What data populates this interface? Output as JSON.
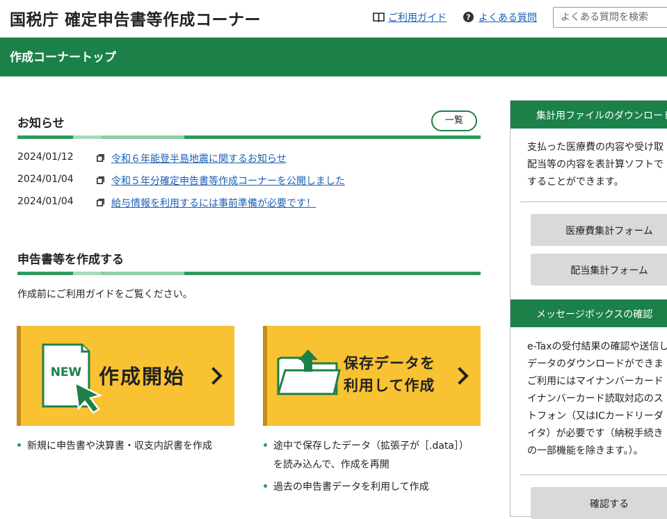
{
  "header": {
    "title": "国税庁 確定申告書等作成コーナー",
    "guide_link": "ご利用ガイド",
    "faq_link": "よくある質問",
    "search_placeholder": "よくある質問を検索"
  },
  "nav": {
    "title": "作成コーナートップ"
  },
  "news": {
    "title": "お知らせ",
    "list_button": "一覧",
    "items": [
      {
        "date": "2024/01/12",
        "text": "令和６年能登半島地震に関するお知らせ"
      },
      {
        "date": "2024/01/04",
        "text": "令和５年分確定申告書等作成コーナーを公開しました"
      },
      {
        "date": "2024/01/04",
        "text": "給与情報を利用するには事前準備が必要です！"
      }
    ]
  },
  "create": {
    "title": "申告書等を作成する",
    "intro": "作成前にご利用ガイドをご覧ください。",
    "new_card": {
      "badge": "NEW",
      "label": "作成開始"
    },
    "saved_card": {
      "line1": "保存データを",
      "line2": "利用して作成"
    },
    "new_bullets": [
      "新規に申告書や決算書・収支内訳書を作成"
    ],
    "saved_bullets": [
      {
        "line1": "途中で保存したデータ（拡張子が［.data］）",
        "line2": "を読み込んで、作成を再開"
      },
      {
        "line1": "過去の申告書データを利用して作成"
      }
    ]
  },
  "sidebar": {
    "download": {
      "title": "集計用ファイルのダウンロード",
      "text": [
        "支払った医療費の内容や受け取",
        "配当等の内容を表計算ソフトで",
        "することができます。"
      ],
      "buttons": [
        "医療費集計フォーム",
        "配当集計フォーム"
      ]
    },
    "messagebox": {
      "title": "メッセージボックスの確認",
      "text": [
        "e-Taxの受付結果の確認や送信し",
        "データのダウンロードができま",
        "ご利用にはマイナンバーカード",
        "イナンバーカード読取対応のス",
        "トフォン（又はICカードリーダ",
        "イタ）が必要です（納税手続き",
        "の一部機能を除きます。）。"
      ],
      "button": "確認する"
    }
  },
  "colors": {
    "brand_green": "#1c8149",
    "card_yellow": "#f9c233",
    "link_blue": "#1a5fb4"
  }
}
